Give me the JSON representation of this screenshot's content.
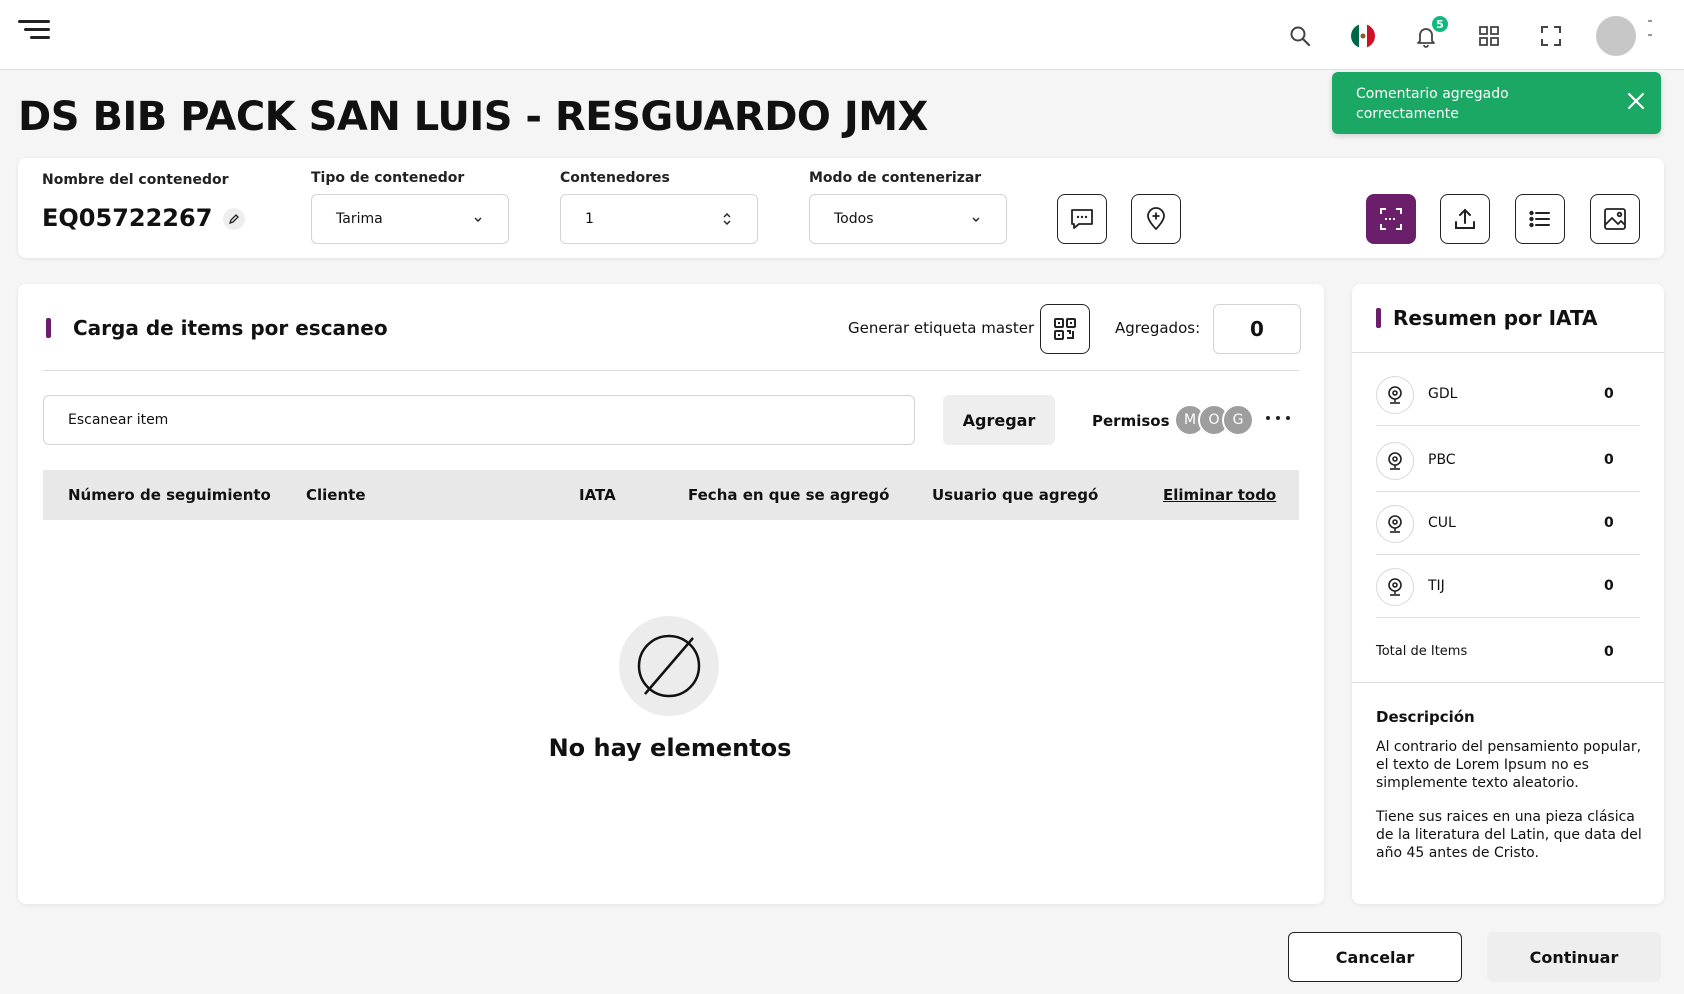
{
  "topbar": {
    "notification_count": "5"
  },
  "page": {
    "title": "DS BIB PACK SAN LUIS - RESGUARDO JMX"
  },
  "toast": {
    "message": "Comentario agregado correctamente"
  },
  "container": {
    "name_label": "Nombre del contenedor",
    "name_value": "EQ05722267",
    "type_label": "Tipo de contenedor",
    "type_value": "Tarima",
    "count_label": "Contenedores",
    "count_value": "1",
    "mode_label": "Modo de contenerizar",
    "mode_value": "Todos"
  },
  "scan": {
    "title": "Carga de items por escaneo",
    "master_label": "Generar etiqueta master",
    "added_label": "Agregados:",
    "added_value": "0",
    "input_placeholder": "Escanear item",
    "add_button": "Agregar",
    "permissions_label": "Permisos",
    "permission_avatars": [
      "M",
      "O",
      "G"
    ],
    "columns": [
      "Número de seguimiento",
      "Cliente",
      "IATA",
      "Fecha en que se agregó",
      "Usuario que agregó"
    ],
    "delete_all": "Eliminar todo",
    "empty_text": "No hay elementos"
  },
  "summary": {
    "title": "Resumen por IATA",
    "rows": [
      {
        "code": "GDL",
        "value": "0"
      },
      {
        "code": "PBC",
        "value": "0"
      },
      {
        "code": "CUL",
        "value": "0"
      },
      {
        "code": "TIJ",
        "value": "0"
      }
    ],
    "total_label": "Total de Items",
    "total_value": "0",
    "description_title": "Descripción",
    "description_p1": "Al contrario del pensamiento popular, el texto de Lorem Ipsum no es simplemente texto aleatorio.",
    "description_p2": "Tiene sus raices en una pieza clásica de la literatura del Latin, que data del año 45 antes de Cristo."
  },
  "footer": {
    "cancel": "Cancelar",
    "continue": "Continuar"
  },
  "colors": {
    "accent": "#6b1f6b",
    "toast": "#1aa864",
    "badge": "#10b981"
  }
}
